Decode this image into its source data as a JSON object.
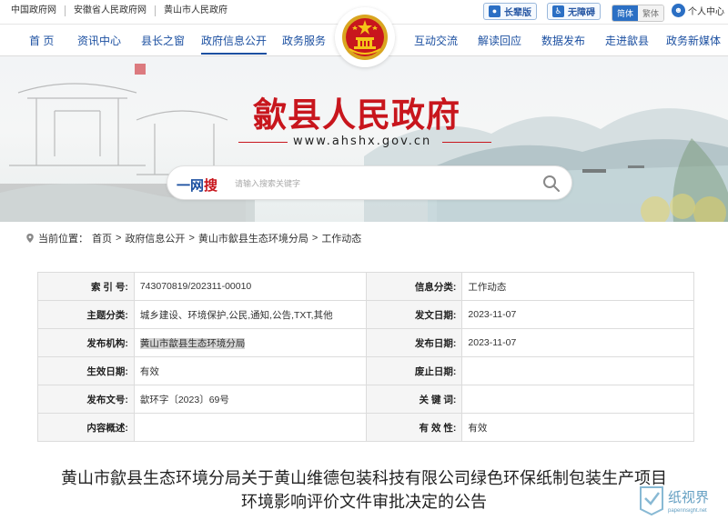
{
  "topbar": {
    "links": [
      "中国政府网",
      "安徽省人民政府网",
      "黄山市人民政府"
    ],
    "elder_label": "长辈版",
    "accessible_label": "无障碍",
    "lang_simplified": "简体",
    "lang_traditional": "繁体",
    "user_label": "个人中心"
  },
  "nav": {
    "items": [
      "首 页",
      "资讯中心",
      "县长之窗",
      "政府信息公开",
      "政务服务",
      "互动交流",
      "解读回应",
      "数据发布",
      "走进歙县",
      "政务新媒体"
    ],
    "active": "政府信息公开"
  },
  "banner": {
    "title": "歙县人民政府",
    "url": "www.ahshx.gov.cn"
  },
  "search": {
    "brand_prefix": "一网",
    "brand_suffix": "搜",
    "placeholder": "请输入搜索关键字"
  },
  "breadcrumb": {
    "prefix": "当前位置：",
    "items": [
      "首页",
      "政府信息公开",
      "黄山市歙县生态环境分局",
      "工作动态"
    ],
    "separator": ">"
  },
  "info": {
    "rows": [
      {
        "k1": "索 引 号:",
        "v1": "743070819/202311-00010",
        "k2": "信息分类:",
        "v2": "工作动态"
      },
      {
        "k1": "主题分类:",
        "v1": "城乡建设、环境保护,公民,通知,公告,TXT,其他",
        "k2": "发文日期:",
        "v2": "2023-11-07"
      },
      {
        "k1": "发布机构:",
        "v1": "黄山市歙县生态环境分局",
        "k2": "发布日期:",
        "v2": "2023-11-07"
      },
      {
        "k1": "生效日期:",
        "v1": "有效",
        "k2": "废止日期:",
        "v2": ""
      },
      {
        "k1": "发布文号:",
        "v1": "歙环字〔2023〕69号",
        "k2": "关 键 词:",
        "v2": ""
      },
      {
        "k1": "内容概述:",
        "v1": "",
        "k2": "有 效 性:",
        "v2": "有效"
      }
    ]
  },
  "article": {
    "title_line1": "黄山市歙县生态环境分局关于黄山维德包装科技有限公司绿色环保纸制包装生产项目",
    "title_line2": "环境影响评价文件审批决定的公告"
  },
  "watermark": {
    "name": "纸视界",
    "url": "paperinsight.net"
  },
  "colors": {
    "primary": "#1c50a1",
    "red": "#c8161d"
  }
}
